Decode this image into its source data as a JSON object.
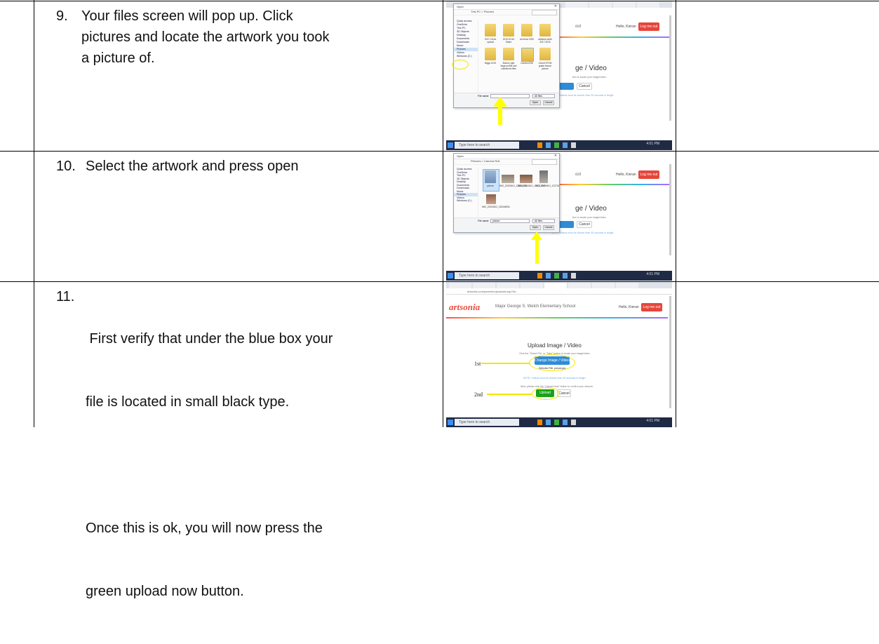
{
  "steps": [
    {
      "number": "9.",
      "lines": [
        "Your files screen will pop up. Click",
        "pictures and locate the artwork you took",
        "a picture of."
      ]
    },
    {
      "number": "10.",
      "lines": [
        "Select the artwork and press open"
      ]
    },
    {
      "number": "11.",
      "lines": [
        " First verify that under the blue box your",
        "file is located in small black type.",
        "",
        "Once this is ok, you will now press the",
        "green upload now button."
      ]
    }
  ],
  "browser": {
    "school_title": "Major George S. Welch Elementary School",
    "hello": "Hello, Kieran",
    "logout": "Log me out",
    "brand": "artsonia",
    "address": "artsonia.com/parents/uploadart.asp?id=",
    "taskbar_search": "Type here to search",
    "clock": "4:01 PM"
  },
  "shot1": {
    "dialog_title": "Open",
    "path": "This PC > Pictures",
    "side_items": [
      "Quick access",
      "OneDrive",
      "This PC",
      "3D Objects",
      "Desktop",
      "Documents",
      "Downloads",
      "Music",
      "Pictures",
      "Videos",
      "Windows (C:)"
    ],
    "folders": [
      "2017-18 art upload",
      "2019-20 Art Share",
      "art show 2020",
      "artifacts week 2017-2020",
      "Biggs 2019",
      "Boxes Light large profile and collections files",
      "Camera Roll",
      "Circuit STEM grade lesson picture"
    ],
    "file_name_label": "File name:",
    "filter": "All files",
    "open": "Open",
    "cancel": "Cancel",
    "page_heading": "ge / Video",
    "page_sub": "tton to locate your image/video.",
    "upload_btn": "Cancel"
  },
  "shot2": {
    "dialog_title": "Open",
    "path": "Pictures > Camera Roll",
    "side_items": [
      "Quick access",
      "OneDrive",
      "This PC",
      "3D Objects",
      "Desktop",
      "Documents",
      "Downloads",
      "Music",
      "Pictures",
      "Videos",
      "Windows (C:)"
    ],
    "files": [
      "picture",
      "IMG_20200401_123534761",
      "IMG_20200401_123717847",
      "IMG_20200401_123751004",
      "IMG_20200402_135345054"
    ],
    "file_name_label": "File name:",
    "file_name_value": "picture",
    "filter": "All files",
    "open": "Open",
    "cancel": "Cancel",
    "page_heading": "ge / Video",
    "page_sub": "tton to locate your image/video.",
    "upload_btn": "Cancel"
  },
  "shot3": {
    "upload_heading": "Upload Image / Video",
    "instructions1": "Click the \"Select File\" or \"Take\" button to locate your image/video.",
    "change_btn": "Change Image / Video",
    "selected_file": "Selected File: picture.jpg",
    "note": "NOTE: Videos must be shorter than 30 seconds in length.",
    "instructions2": "Next, please click the \"Upload Now\" button to confirm your artwork.",
    "upload_now": "Upload now",
    "cancel": "Cancel",
    "label_1st": "1st",
    "label_2nd": "2nd"
  },
  "colors": {
    "highlight": "#ffff00",
    "upload_green": "#17a317",
    "select_blue": "#2f8bd6",
    "logout_red": "#e5463b"
  }
}
